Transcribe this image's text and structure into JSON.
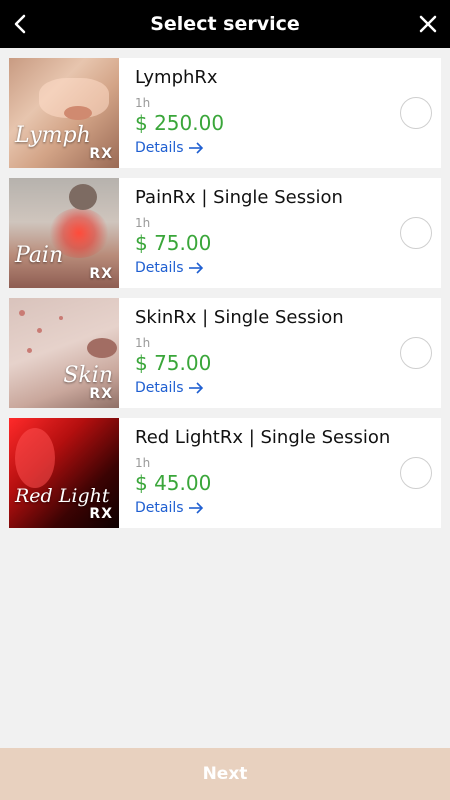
{
  "header": {
    "title": "Select service",
    "back_icon": "chevron-left-icon",
    "close_icon": "close-icon"
  },
  "services": [
    {
      "name": "LymphRx",
      "duration": "1h",
      "price": "$ 250.00",
      "details_label": "Details",
      "image_caption": "Lymph",
      "image_badge": "RX",
      "selected": false
    },
    {
      "name": "PainRx | Single Session",
      "duration": "1h",
      "price": "$ 75.00",
      "details_label": "Details",
      "image_caption": "Pain",
      "image_badge": "RX",
      "selected": false
    },
    {
      "name": "SkinRx | Single Session",
      "duration": "1h",
      "price": "$ 75.00",
      "details_label": "Details",
      "image_caption": "Skin",
      "image_badge": "RX",
      "selected": false
    },
    {
      "name": "Red LightRx | Single Session",
      "duration": "1h",
      "price": "$ 45.00",
      "details_label": "Details",
      "image_caption": "Red Light",
      "image_badge": "RX",
      "selected": false
    }
  ],
  "footer": {
    "next_label": "Next"
  },
  "colors": {
    "header_bg": "#000000",
    "price": "#3aa63a",
    "link": "#1f5fd1",
    "footer_bg": "#e8d1bf"
  }
}
